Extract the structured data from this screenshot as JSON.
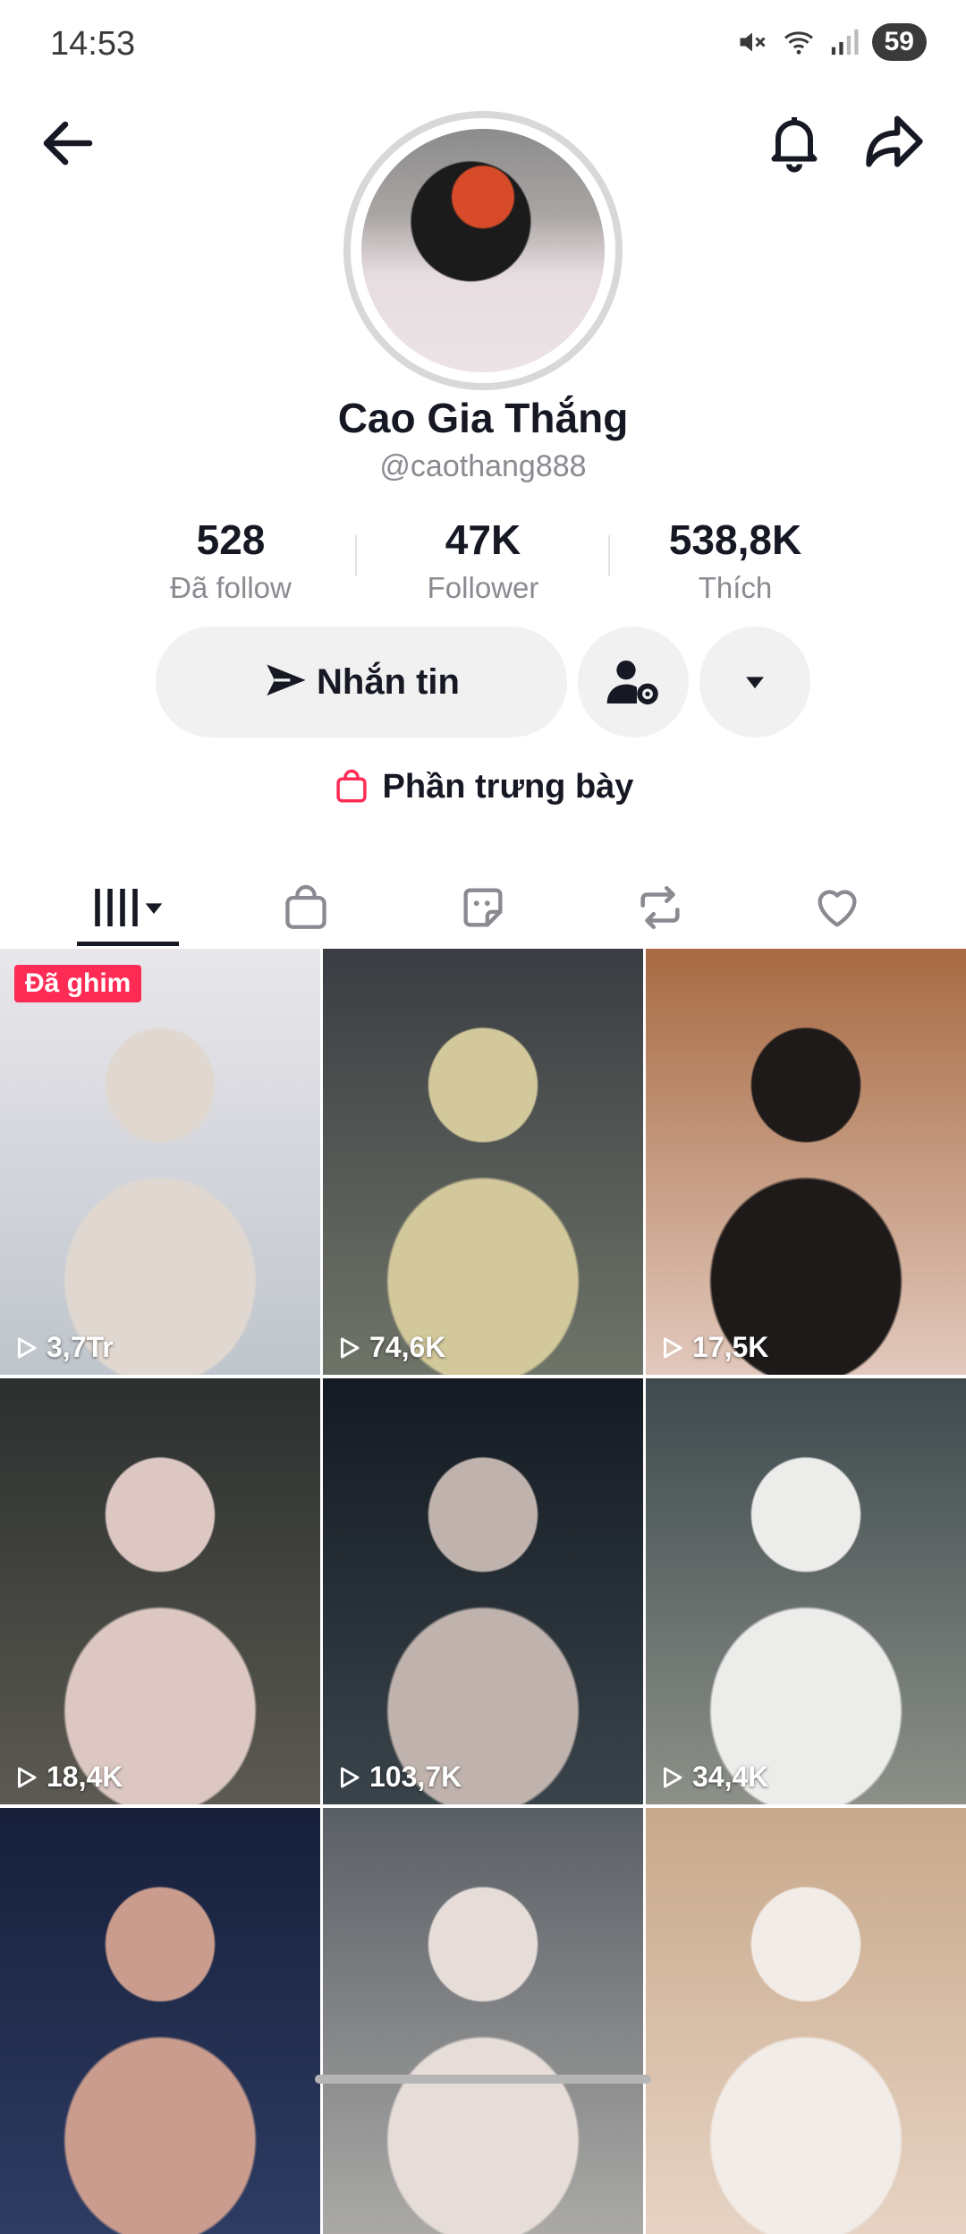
{
  "status_bar": {
    "time": "14:53",
    "battery": "59"
  },
  "profile": {
    "name": "Cao Gia Thắng",
    "handle": "@caothang888",
    "stats": [
      {
        "value": "528",
        "label": "Đã follow"
      },
      {
        "value": "47K",
        "label": "Follower"
      },
      {
        "value": "538,8K",
        "label": "Thích"
      }
    ],
    "message_button": "Nhắn tin",
    "showcase_label": "Phần trưng bày"
  },
  "tabs": [
    "videos-tab",
    "shop-tab",
    "sticker-tab",
    "repost-tab",
    "liked-tab"
  ],
  "videos": [
    {
      "views": "3,7Tr",
      "pinned_label": "Đã ghim",
      "colors": [
        "#e9e7ec",
        "#bfc5cc",
        "#e0d8d0"
      ]
    },
    {
      "views": "74,6K",
      "colors": [
        "#3a3d42",
        "#6f7468",
        "#d2c89b"
      ]
    },
    {
      "views": "17,5K",
      "colors": [
        "#a76a42",
        "#e2c9bd",
        "#1e1a1a"
      ]
    },
    {
      "views": "18,4K",
      "colors": [
        "#2b2f2e",
        "#5c5a52",
        "#dcc7c2"
      ]
    },
    {
      "views": "103,7K",
      "colors": [
        "#141a22",
        "#39444a",
        "#c0b3ad"
      ]
    },
    {
      "views": "34,4K",
      "colors": [
        "#3e4a4e",
        "#8c9088",
        "#ececea"
      ]
    },
    {
      "views": "",
      "colors": [
        "#17203a",
        "#2e3c64",
        "#c99c8d"
      ]
    },
    {
      "views": "",
      "colors": [
        "#5a5f66",
        "#aaa9a6",
        "#e7ddd8"
      ]
    },
    {
      "views": "",
      "colors": [
        "#c8a88a",
        "#e6d3c4",
        "#f2ece8"
      ]
    }
  ],
  "accent_color": "#fe2c55"
}
